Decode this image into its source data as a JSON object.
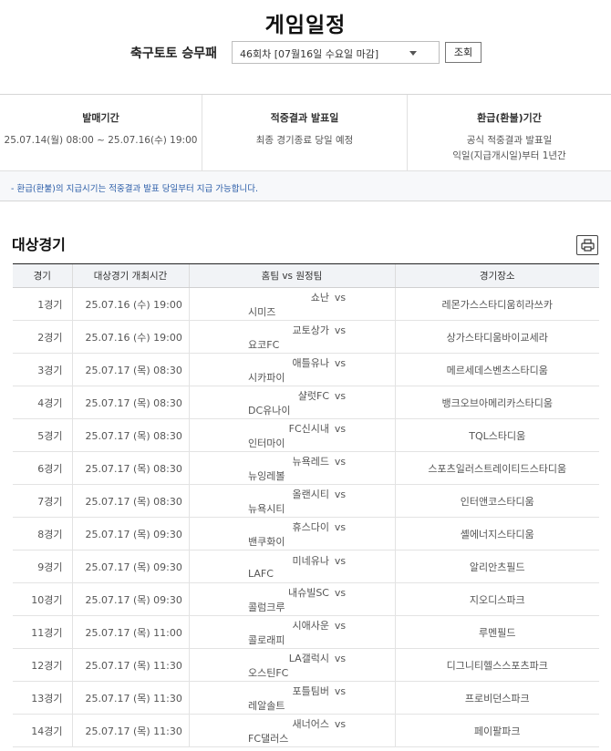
{
  "page": {
    "title": "게임일정"
  },
  "selector": {
    "game_name": "축구토토 승무패",
    "round_value": "46회차 [07월16일 수요일 마감]",
    "lookup_label": "조회"
  },
  "info": {
    "sale_period": {
      "label": "발매기간",
      "value": "25.07.14(월) 08:00 ~ 25.07.16(수) 19:00"
    },
    "result_date": {
      "label": "적중결과 발표일",
      "value": "최종 경기종료 당일 예정"
    },
    "refund_period": {
      "label": "환급(환불)기간",
      "line1": "공식 적중결과 발표일",
      "line2": "익일(지급개시일)부터 1년간"
    },
    "notice": "- 환급(환불)의 지급시기는 적중결과 발표 당일부터 지급 가능합니다."
  },
  "section": {
    "title": "대상경기"
  },
  "table": {
    "headers": {
      "game": "경기",
      "time": "대상경기 개최시간",
      "teams": "홈팀 vs 원정팀",
      "venue": "경기장소"
    },
    "vs": "vs",
    "rows": [
      {
        "no": "1경기",
        "time": "25.07.16 (수) 19:00",
        "home": "쇼난",
        "away": "시미즈",
        "venue": "레몬가스스타디움히라쓰카"
      },
      {
        "no": "2경기",
        "time": "25.07.16 (수) 19:00",
        "home": "교토상가",
        "away": "요코FC",
        "venue": "상가스타디움바이교세라"
      },
      {
        "no": "3경기",
        "time": "25.07.17 (목) 08:30",
        "home": "애틀유나",
        "away": "시카파이",
        "venue": "메르세데스벤츠스타디움"
      },
      {
        "no": "4경기",
        "time": "25.07.17 (목) 08:30",
        "home": "샬럿FC",
        "away": "DC유나이",
        "venue": "뱅크오브아메리카스타디움"
      },
      {
        "no": "5경기",
        "time": "25.07.17 (목) 08:30",
        "home": "FC신시내",
        "away": "인터마이",
        "venue": "TQL스타디움"
      },
      {
        "no": "6경기",
        "time": "25.07.17 (목) 08:30",
        "home": "뉴욕레드",
        "away": "뉴잉레볼",
        "venue": "스포츠일러스트레이티드스타디움"
      },
      {
        "no": "7경기",
        "time": "25.07.17 (목) 08:30",
        "home": "올랜시티",
        "away": "뉴욕시티",
        "venue": "인터앤코스타디움"
      },
      {
        "no": "8경기",
        "time": "25.07.17 (목) 09:30",
        "home": "휴스다이",
        "away": "밴쿠화이",
        "venue": "셸에너지스타디움"
      },
      {
        "no": "9경기",
        "time": "25.07.17 (목) 09:30",
        "home": "미네유나",
        "away": "LAFC",
        "venue": "알리안츠필드"
      },
      {
        "no": "10경기",
        "time": "25.07.17 (목) 09:30",
        "home": "내슈빌SC",
        "away": "콜럼크루",
        "venue": "지오디스파크"
      },
      {
        "no": "11경기",
        "time": "25.07.17 (목) 11:00",
        "home": "시애사운",
        "away": "콜로래피",
        "venue": "루멘필드"
      },
      {
        "no": "12경기",
        "time": "25.07.17 (목) 11:30",
        "home": "LA갤럭시",
        "away": "오스틴FC",
        "venue": "디그니티헬스스포츠파크"
      },
      {
        "no": "13경기",
        "time": "25.07.17 (목) 11:30",
        "home": "포틀팀버",
        "away": "레알솔트",
        "venue": "프로비던스파크"
      },
      {
        "no": "14경기",
        "time": "25.07.17 (목) 11:30",
        "home": "새너어스",
        "away": "FC댈러스",
        "venue": "페이팔파크"
      }
    ]
  }
}
